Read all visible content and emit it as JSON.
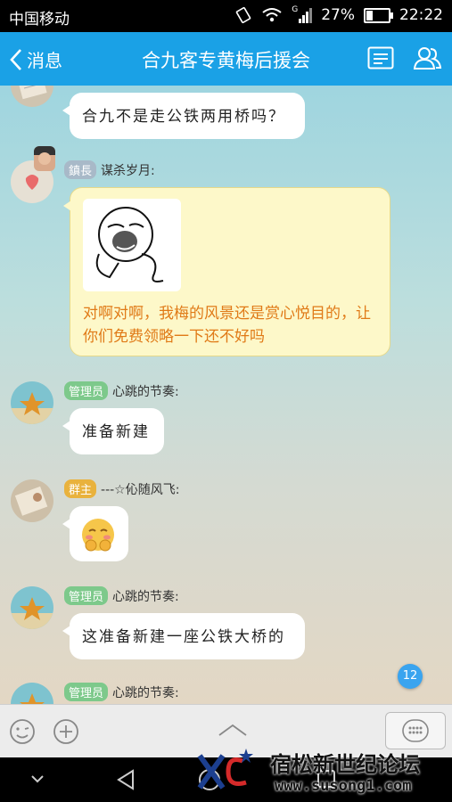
{
  "status_bar": {
    "carrier": "中国移动",
    "signal_label": "G",
    "battery": "27%",
    "time": "22:22"
  },
  "header": {
    "back_label": "消息",
    "title": "合九客专黄梅后援会"
  },
  "messages": [
    {
      "text": "合九不是走公铁两用桥吗？"
    },
    {
      "tag": "鎮長",
      "name": "谋杀岁月:",
      "sticker": "meme-face-sticker",
      "text": "对啊对啊，我梅的风景还是赏心悦目的，让你们免费领略一下还不好吗"
    },
    {
      "tag": "管理员",
      "name": "心跳的节奏:",
      "text": "准备新建"
    },
    {
      "tag": "群主",
      "name": "---☆伈随风飞:",
      "emoji": "shy-face-emoji"
    },
    {
      "tag": "管理员",
      "name": "心跳的节奏:",
      "text": "这准备新建一座公铁大桥的"
    },
    {
      "tag": "管理员",
      "name": "心跳的节奏:"
    }
  ],
  "unread_count": "12",
  "icons": [
    "back-chevron-icon",
    "group-file-icon",
    "group-members-icon",
    "emoji-icon",
    "plus-icon",
    "expand-up-icon",
    "keyboard-icon",
    "nav-back-icon",
    "nav-home-icon",
    "nav-recent-icon",
    "chevron-down-icon"
  ],
  "watermark": {
    "title": "宿松新世纪论坛",
    "url": "www.susong1.com"
  },
  "colors": {
    "header_bg": "#1aa1e6",
    "admin_tag": "#7dc98b",
    "owner_tag": "#e9b23d",
    "highlight_text": "#e07a17"
  }
}
